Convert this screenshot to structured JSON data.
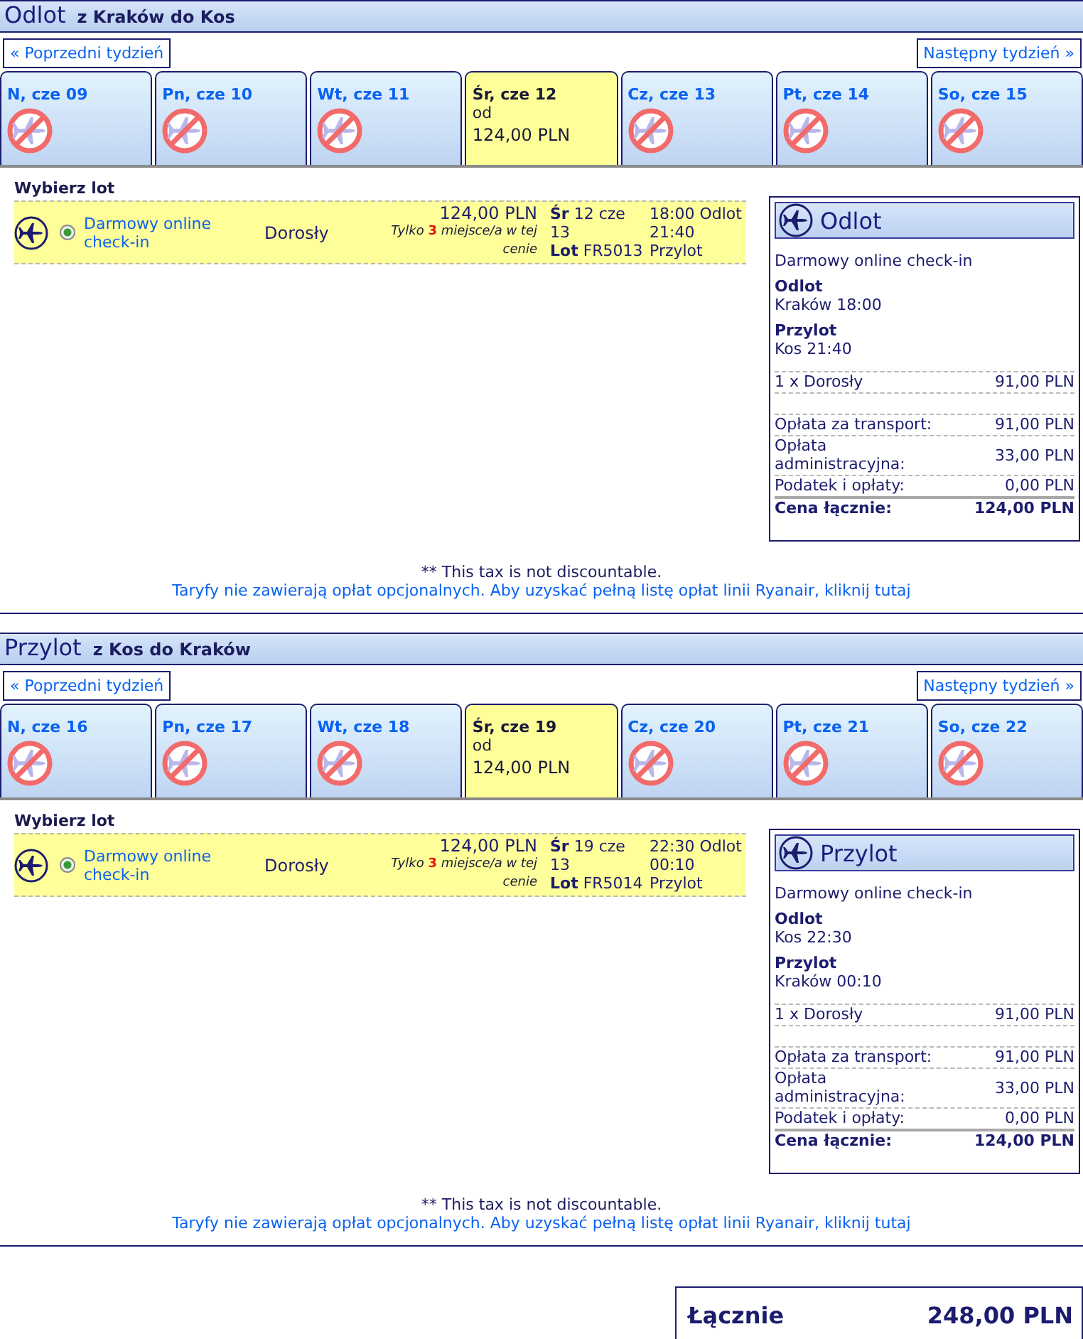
{
  "sections": [
    {
      "title": "Odlot",
      "route": "z Kraków do Kos",
      "prev_week": "« Poprzedni tydzień",
      "next_week": "Następny tydzień »",
      "days": [
        {
          "label": "N, cze 09",
          "kind": "no-flight",
          "selected": false
        },
        {
          "label": "Pn, cze 10",
          "kind": "no-flight",
          "selected": false
        },
        {
          "label": "Wt, cze 11",
          "kind": "no-flight",
          "selected": false
        },
        {
          "label": "Śr, cze 12",
          "kind": "fare",
          "selected": true,
          "from": "od",
          "price": "124,00 PLN"
        },
        {
          "label": "Cz, cze 13",
          "kind": "no-flight",
          "selected": false
        },
        {
          "label": "Pt, cze 14",
          "kind": "no-flight",
          "selected": false
        },
        {
          "label": "So, cze 15",
          "kind": "no-flight",
          "selected": false
        }
      ],
      "choose_label": "Wybierz lot",
      "flights": [
        {
          "selected": true,
          "fare_name": "Darmowy online check-in",
          "passenger": "Dorosły",
          "price": "124,00 PLN",
          "seats_note": "Tylko **3** miejsce/a w tej cenie",
          "date": "**Śr** 12 cze 13",
          "flight_no": "**Lot** FR5013",
          "departure": "18:00 Odlot",
          "arrival": "21:40 Przylot"
        }
      ],
      "summary": {
        "title": "Odlot",
        "fare_name": "Darmowy online check-in",
        "legs": [
          {
            "label": "Odlot",
            "value": "Kraków 18:00"
          },
          {
            "label": "Przylot",
            "value": "Kos 21:40"
          }
        ],
        "passengers": [
          {
            "label": "1 x Dorosły",
            "amount": "91,00 PLN"
          }
        ],
        "fees": [
          {
            "label": "Opłata za transport:",
            "amount": "91,00 PLN"
          },
          {
            "label": "Opłata administracyjna:",
            "amount": "33,00 PLN"
          },
          {
            "label": "Podatek i opłaty:",
            "amount": "0,00 PLN"
          }
        ],
        "total": {
          "label": "Cena łącznie:",
          "amount": "124,00 PLN"
        }
      },
      "tax_note": "** This tax is not discountable.",
      "fees_link": "Taryfy nie zawierają opłat opcjonalnych. Aby uzyskać pełną listę opłat linii Ryanair, kliknij tutaj"
    },
    {
      "title": "Przylot",
      "route": "z Kos do Kraków",
      "prev_week": "« Poprzedni tydzień",
      "next_week": "Następny tydzień »",
      "days": [
        {
          "label": "N, cze 16",
          "kind": "no-flight",
          "selected": false
        },
        {
          "label": "Pn, cze 17",
          "kind": "no-flight",
          "selected": false
        },
        {
          "label": "Wt, cze 18",
          "kind": "no-flight",
          "selected": false
        },
        {
          "label": "Śr, cze 19",
          "kind": "fare",
          "selected": true,
          "from": "od",
          "price": "124,00 PLN"
        },
        {
          "label": "Cz, cze 20",
          "kind": "no-flight",
          "selected": false
        },
        {
          "label": "Pt, cze 21",
          "kind": "no-flight",
          "selected": false
        },
        {
          "label": "So, cze 22",
          "kind": "no-flight",
          "selected": false
        }
      ],
      "choose_label": "Wybierz lot",
      "flights": [
        {
          "selected": true,
          "fare_name": "Darmowy online check-in",
          "passenger": "Dorosły",
          "price": "124,00 PLN",
          "seats_note": "Tylko **3** miejsce/a w tej cenie",
          "date": "**Śr** 19 cze 13",
          "flight_no": "**Lot** FR5014",
          "departure": "22:30 Odlot",
          "arrival": "00:10 Przylot"
        }
      ],
      "summary": {
        "title": "Przylot",
        "fare_name": "Darmowy online check-in",
        "legs": [
          {
            "label": "Odlot",
            "value": "Kos 22:30"
          },
          {
            "label": "Przylot",
            "value": "Kraków 00:10"
          }
        ],
        "passengers": [
          {
            "label": "1 x Dorosły",
            "amount": "91,00 PLN"
          }
        ],
        "fees": [
          {
            "label": "Opłata za transport:",
            "amount": "91,00 PLN"
          },
          {
            "label": "Opłata administracyjna:",
            "amount": "33,00 PLN"
          },
          {
            "label": "Podatek i opłaty:",
            "amount": "0,00 PLN"
          }
        ],
        "total": {
          "label": "Cena łącznie:",
          "amount": "124,00 PLN"
        }
      },
      "tax_note": "** This tax is not discountable.",
      "fees_link": "Taryfy nie zawierają opłat opcjonalnych. Aby uzyskać pełną listę opłat linii Ryanair, kliknij tutaj"
    }
  ],
  "grand_total": {
    "label": "Łącznie",
    "amount": "248,00 PLN"
  }
}
